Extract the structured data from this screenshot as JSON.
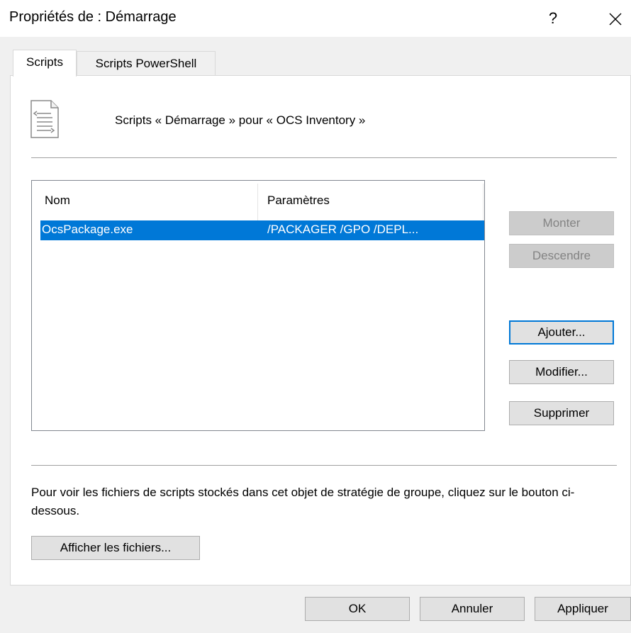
{
  "window": {
    "title": "Propriétés de : Démarrage",
    "help_label": "?"
  },
  "tabs": [
    {
      "label": "Scripts",
      "active": true
    },
    {
      "label": "Scripts PowerShell",
      "active": false
    }
  ],
  "scripts_panel": {
    "heading": "Scripts « Démarrage » pour « OCS Inventory »",
    "icon": "script-file-icon",
    "list": {
      "columns": [
        "Nom",
        "Paramètres"
      ],
      "rows": [
        {
          "name": "OcsPackage.exe",
          "params": "/PACKAGER /GPO /DEPL...",
          "selected": true
        }
      ]
    },
    "buttons": {
      "up": "Monter",
      "down": "Descendre",
      "add": "Ajouter...",
      "edit": "Modifier...",
      "remove": "Supprimer"
    },
    "info_text": "Pour voir les fichiers de scripts stockés dans cet objet de stratégie de groupe, cliquez sur le bouton ci-dessous.",
    "show_files": "Afficher les fichiers..."
  },
  "footer": {
    "ok": "OK",
    "cancel": "Annuler",
    "apply": "Appliquer"
  },
  "colors": {
    "selection": "#0078d7",
    "focus_border": "#0078d7",
    "window_bg": "#f0f0f0"
  }
}
